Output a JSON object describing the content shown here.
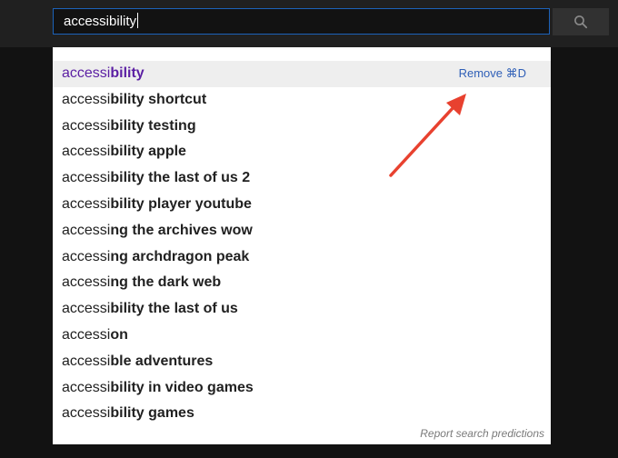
{
  "search": {
    "value": "accessibility",
    "icon": "search-icon"
  },
  "suggestions": [
    {
      "typed": "accessi",
      "completion": "bility",
      "history": true
    },
    {
      "typed": "accessi",
      "completion": "bility shortcut"
    },
    {
      "typed": "accessi",
      "completion": "bility testing"
    },
    {
      "typed": "accessi",
      "completion": "bility apple"
    },
    {
      "typed": "accessi",
      "completion": "bility the last of us 2"
    },
    {
      "typed": "accessi",
      "completion": "bility player youtube"
    },
    {
      "typed": "accessi",
      "completion": "ng the archives wow"
    },
    {
      "typed": "accessi",
      "completion": "ng archdragon peak"
    },
    {
      "typed": "accessi",
      "completion": "ng the dark web"
    },
    {
      "typed": "accessi",
      "completion": "bility the last of us"
    },
    {
      "typed": "accessi",
      "completion": "on"
    },
    {
      "typed": "accessi",
      "completion": "ble adventures"
    },
    {
      "typed": "accessi",
      "completion": "bility in video games"
    },
    {
      "typed": "accessi",
      "completion": "bility games"
    }
  ],
  "remove_label": "Remove ⌘D",
  "report_label": "Report search predictions",
  "colors": {
    "history_suggestion": "#5b1fa3",
    "link": "#2f5fb7",
    "arrow": "#e8412f",
    "input_border": "#1c62b9"
  }
}
